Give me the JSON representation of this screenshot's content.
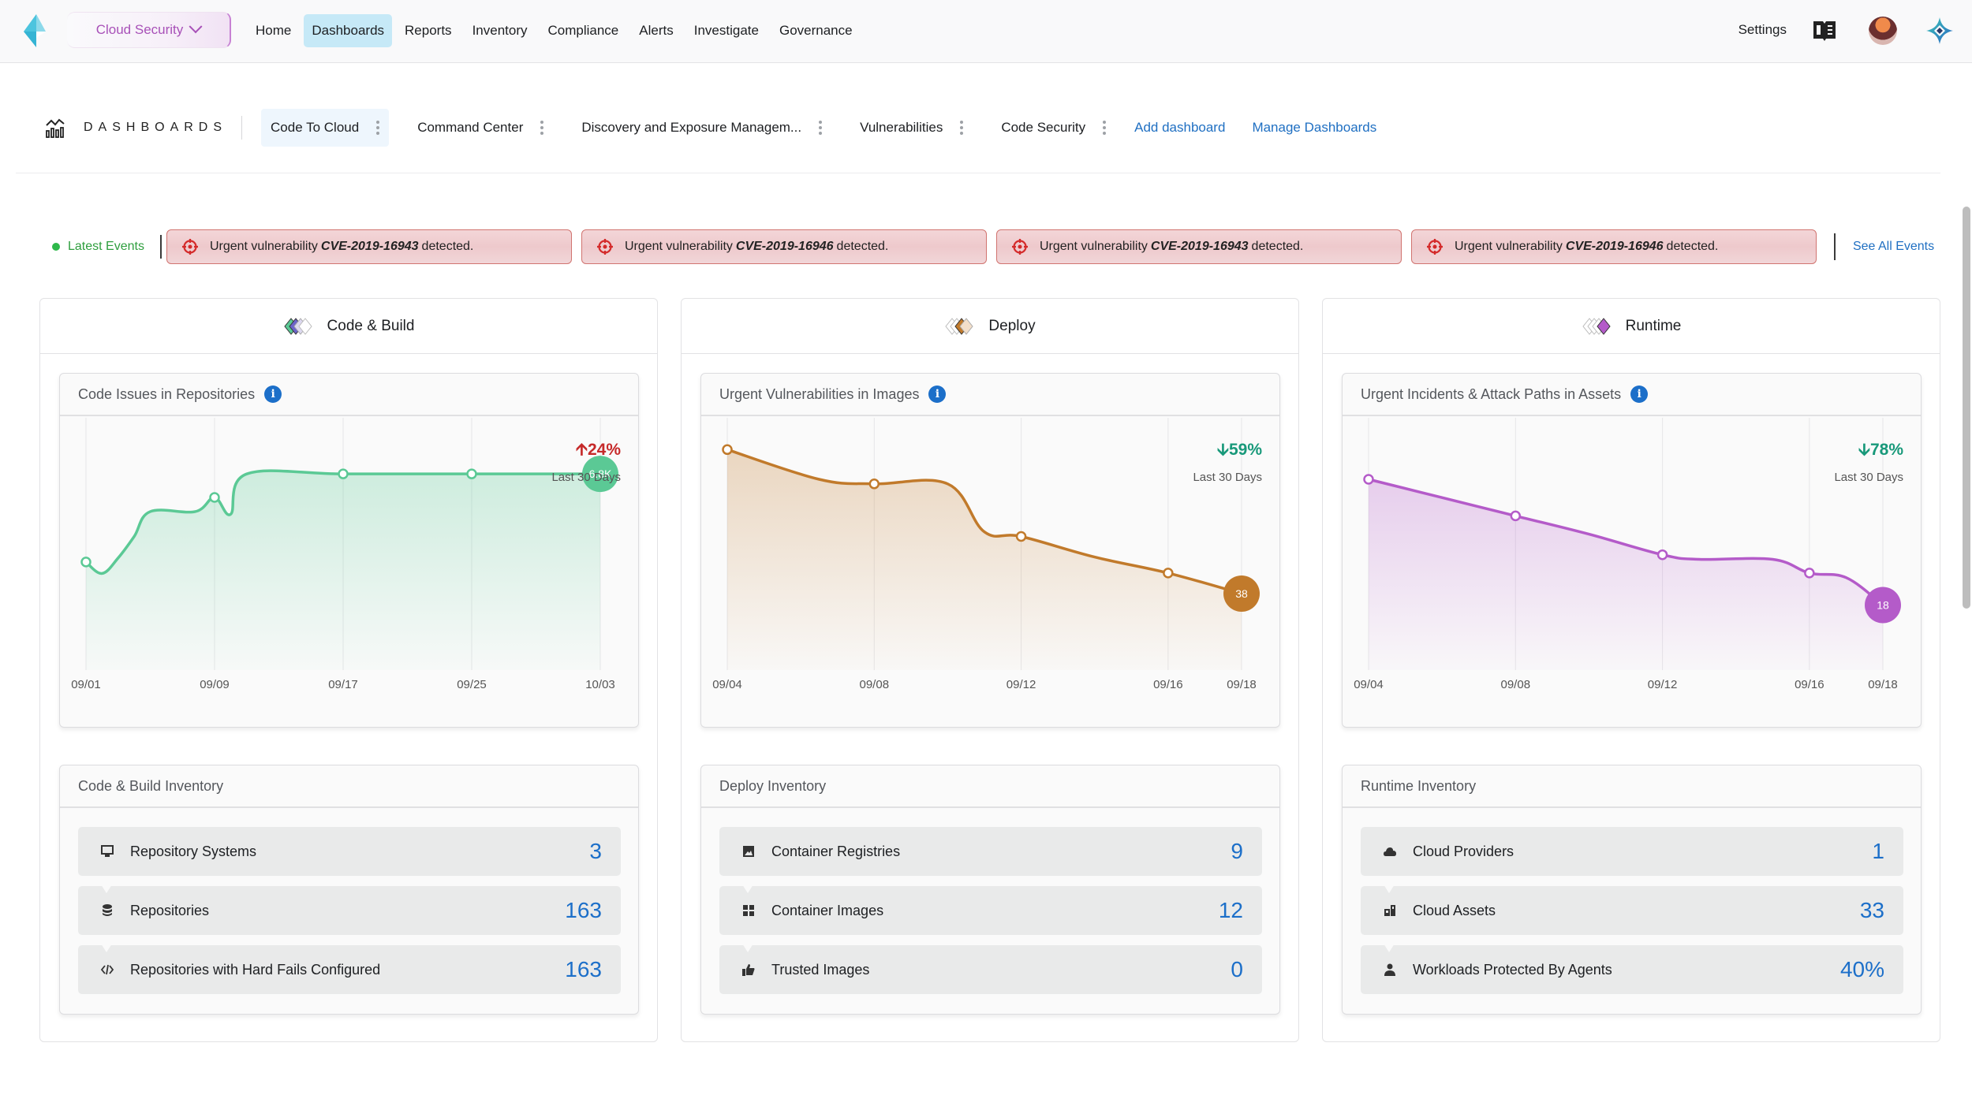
{
  "topnav": {
    "product": "Cloud Security",
    "items": [
      {
        "label": "Home",
        "active": false
      },
      {
        "label": "Dashboards",
        "active": true
      },
      {
        "label": "Reports",
        "active": false
      },
      {
        "label": "Inventory",
        "active": false
      },
      {
        "label": "Compliance",
        "active": false
      },
      {
        "label": "Alerts",
        "active": false
      },
      {
        "label": "Investigate",
        "active": false
      },
      {
        "label": "Governance",
        "active": false
      }
    ],
    "settings_label": "Settings",
    "icons": [
      "logo-icon",
      "book-icon",
      "avatar",
      "brand-icon"
    ]
  },
  "dashboards": {
    "title": "DASHBOARDS",
    "tabs": [
      {
        "label": "Code To Cloud",
        "active": true
      },
      {
        "label": "Command Center",
        "active": false
      },
      {
        "label": "Discovery and Exposure Managem...",
        "active": false
      },
      {
        "label": "Vulnerabilities",
        "active": false
      },
      {
        "label": "Code Security",
        "active": false
      }
    ],
    "add_label": "Add dashboard",
    "manage_label": "Manage Dashboards"
  },
  "events": {
    "latest_label": "Latest Events",
    "items": [
      {
        "prefix": "Urgent vulnerability",
        "cve": "CVE-2019-16943",
        "suffix": "detected."
      },
      {
        "prefix": "Urgent vulnerability",
        "cve": "CVE-2019-16946",
        "suffix": "detected."
      },
      {
        "prefix": "Urgent vulnerability",
        "cve": "CVE-2019-16943",
        "suffix": "detected."
      },
      {
        "prefix": "Urgent vulnerability",
        "cve": "CVE-2019-16946",
        "suffix": "detected."
      }
    ],
    "see_all_label": "See All Events"
  },
  "columns": [
    {
      "title": "Code & Build",
      "chart_title": "Code Issues in Repositories",
      "trend": {
        "direction": "up",
        "value": "24%",
        "period": "Last 30 Days"
      },
      "inventory_title": "Code & Build Inventory",
      "inventory": [
        {
          "icon": "monitor-icon",
          "label": "Repository Systems",
          "value": "3"
        },
        {
          "icon": "database-icon",
          "label": "Repositories",
          "value": "163"
        },
        {
          "icon": "code-icon",
          "label": "Repositories with Hard Fails Configured",
          "value": "163"
        }
      ]
    },
    {
      "title": "Deploy",
      "chart_title": "Urgent Vulnerabilities in Images",
      "trend": {
        "direction": "down",
        "value": "59%",
        "period": "Last 30 Days"
      },
      "inventory_title": "Deploy Inventory",
      "inventory": [
        {
          "icon": "image-icon",
          "label": "Container Registries",
          "value": "9"
        },
        {
          "icon": "grid-icon",
          "label": "Container Images",
          "value": "12"
        },
        {
          "icon": "thumbs-up-icon",
          "label": "Trusted Images",
          "value": "0"
        }
      ]
    },
    {
      "title": "Runtime",
      "chart_title": "Urgent Incidents & Attack Paths in Assets",
      "trend": {
        "direction": "down",
        "value": "78%",
        "period": "Last 30 Days"
      },
      "inventory_title": "Runtime Inventory",
      "inventory": [
        {
          "icon": "cloud-icon",
          "label": "Cloud Providers",
          "value": "1"
        },
        {
          "icon": "assets-icon",
          "label": "Cloud Assets",
          "value": "33"
        },
        {
          "icon": "user-icon",
          "label": "Workloads Protected By Agents",
          "value": "40%"
        }
      ]
    }
  ],
  "chart_data": [
    {
      "type": "area",
      "title": "Code Issues in Repositories",
      "color": "#5bc995",
      "x_ticks": [
        "09/01",
        "09/09",
        "09/17",
        "09/25",
        "10/03"
      ],
      "end_label": "6.8K",
      "ylim": [
        4000,
        7400
      ],
      "points": [
        {
          "x": 0,
          "y": 5490,
          "marker": true
        },
        {
          "x": 1,
          "y": 5320
        },
        {
          "x": 2,
          "y": 5550
        },
        {
          "x": 3,
          "y": 5870
        },
        {
          "x": 4,
          "y": 6240
        },
        {
          "x": 6.8,
          "y": 6240
        },
        {
          "x": 8,
          "y": 6450,
          "marker": true
        },
        {
          "x": 9,
          "y": 6200
        },
        {
          "x": 10,
          "y": 6800
        },
        {
          "x": 16,
          "y": 6800,
          "marker": true
        },
        {
          "x": 24,
          "y": 6800,
          "marker": true
        },
        {
          "x": 32,
          "y": 6800
        }
      ]
    },
    {
      "type": "area",
      "title": "Urgent Vulnerabilities in Images",
      "color": "#c17a2b",
      "x_ticks": [
        "09/04",
        "09/08",
        "09/12",
        "09/16",
        "09/18"
      ],
      "end_label": "38",
      "ylim": [
        0,
        100
      ],
      "points": [
        {
          "x": 0,
          "y": 93,
          "marker": true
        },
        {
          "x": 2.5,
          "y": 80
        },
        {
          "x": 4,
          "y": 78,
          "marker": true
        },
        {
          "x": 6,
          "y": 78
        },
        {
          "x": 7,
          "y": 57
        },
        {
          "x": 8,
          "y": 55,
          "marker": true
        },
        {
          "x": 10,
          "y": 46
        },
        {
          "x": 12,
          "y": 39,
          "marker": true
        },
        {
          "x": 14,
          "y": 30
        }
      ]
    },
    {
      "type": "area",
      "title": "Urgent Incidents & Attack Paths in Assets",
      "color": "#b45bc9",
      "x_ticks": [
        "09/04",
        "09/08",
        "09/12",
        "09/16",
        "09/18"
      ],
      "end_label": "18",
      "ylim": [
        0,
        100
      ],
      "points": [
        {
          "x": 0,
          "y": 80,
          "marker": true
        },
        {
          "x": 2,
          "y": 72
        },
        {
          "x": 4,
          "y": 64,
          "marker": true
        },
        {
          "x": 6,
          "y": 56
        },
        {
          "x": 8,
          "y": 47,
          "marker": true
        },
        {
          "x": 9,
          "y": 45
        },
        {
          "x": 11,
          "y": 45
        },
        {
          "x": 12,
          "y": 39,
          "marker": true
        },
        {
          "x": 13,
          "y": 37
        },
        {
          "x": 14,
          "y": 25
        }
      ]
    }
  ]
}
